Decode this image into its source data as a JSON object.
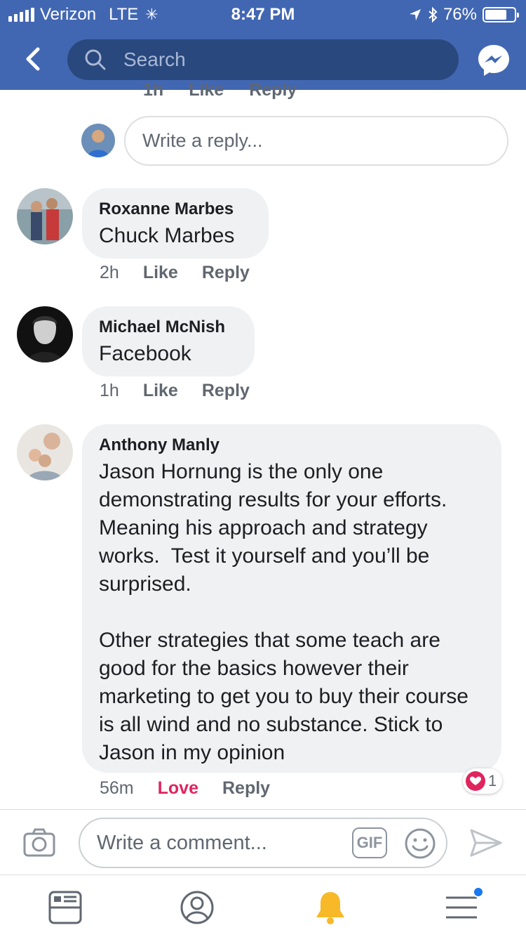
{
  "status_bar": {
    "carrier": "Verizon",
    "network": "LTE",
    "time": "8:47 PM",
    "battery": "76%",
    "battery_level": 0.76
  },
  "header": {
    "search_placeholder": "Search",
    "back_icon": "chevron-left-icon",
    "messenger_icon": "messenger-icon"
  },
  "thread": {
    "previous_actions": [
      "1h",
      "Like",
      "Reply"
    ],
    "reply_placeholder": "Write a reply..."
  },
  "comments": [
    {
      "author": "Roxanne Marbes",
      "text": "Chuck Marbes",
      "time": "2h",
      "like_label": "Like",
      "reply_label": "Reply"
    },
    {
      "author": "Michael McNish",
      "text": "Facebook",
      "time": "1h",
      "like_label": "Like",
      "reply_label": "Reply"
    },
    {
      "author": "Anthony Manly",
      "text": "Jason Hornung is the only one demonstrating results for your efforts. Meaning his approach and strategy works.  Test it yourself and you’ll be surprised.\n\nOther strategies that some teach are good for the basics however their marketing to get you to buy their course is all wind and no substance. Stick to Jason in my opinion",
      "time": "56m",
      "like_label": "Love",
      "reply_label": "Reply",
      "reaction_count": "1"
    }
  ],
  "composer": {
    "placeholder": "Write a comment...",
    "gif_label": "GIF"
  },
  "tabs": [
    "news-feed-icon",
    "profile-icon",
    "notifications-bell-icon",
    "menu-icon"
  ],
  "colors": {
    "brand": "#4267b2",
    "search_bg": "#29487d",
    "love": "#e0245e",
    "bell": "#f7b928"
  }
}
